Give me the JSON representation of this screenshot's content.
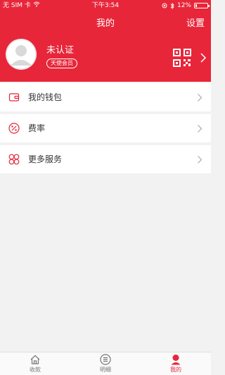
{
  "status_bar": {
    "carrier": "无 SIM 卡",
    "time": "下午3:54",
    "battery_text": "12%",
    "battery_level": 0.12
  },
  "nav": {
    "title": "我的",
    "settings_label": "设置"
  },
  "profile": {
    "name": "未认证",
    "badge": "天使会员"
  },
  "menu": [
    {
      "label": "我的钱包",
      "icon": "wallet-icon"
    },
    {
      "label": "费率",
      "icon": "percent-icon"
    },
    {
      "label": "更多服务",
      "icon": "services-icon"
    }
  ],
  "tabs": [
    {
      "label": "收款",
      "icon": "home-icon",
      "active": false
    },
    {
      "label": "明细",
      "icon": "list-icon",
      "active": false
    },
    {
      "label": "我的",
      "icon": "profile-icon",
      "active": true
    }
  ],
  "colors": {
    "brand": "#e8263a",
    "background": "#f2f2f2"
  }
}
